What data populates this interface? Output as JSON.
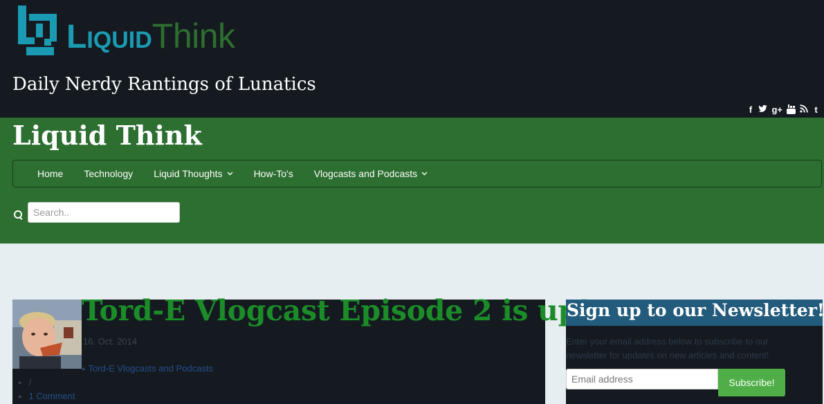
{
  "header": {
    "logo_text_liquid": "Liquid",
    "logo_text_think": "Think",
    "tagline": "Daily Nerdy Rantings of Lunatics",
    "social": [
      {
        "icon": "facebook-icon",
        "glyph": "f"
      },
      {
        "icon": "twitter-icon",
        "glyph": "t"
      },
      {
        "icon": "googleplus-icon",
        "glyph": "g+"
      },
      {
        "icon": "youtube-icon",
        "glyph": "▶"
      },
      {
        "icon": "rss-icon",
        "glyph": "≈"
      },
      {
        "icon": "tumblr-icon",
        "glyph": "t"
      }
    ]
  },
  "site": {
    "title": "Liquid Think"
  },
  "nav": {
    "items": [
      {
        "label": "Home",
        "dropdown": false
      },
      {
        "label": "Technology",
        "dropdown": false
      },
      {
        "label": "Liquid Thoughts",
        "dropdown": true
      },
      {
        "label": "How-To's",
        "dropdown": false
      },
      {
        "label": "Vlogcasts and Podcasts",
        "dropdown": true
      }
    ]
  },
  "search": {
    "placeholder": "Search.."
  },
  "post": {
    "title": "Tord-E Vlogcast Episode 2 is up!",
    "date": "16. Oct. 2014",
    "category": "Tord-E Vlogcasts and Podcasts",
    "separator": "/",
    "comments": "1 Comment"
  },
  "newsletter": {
    "title": "Sign up to our Newsletter!",
    "description": "Enter your email address below to subscribe to our newsletter for updates on new articles and content!",
    "email_placeholder": "Email address",
    "subscribe_label": "Subscribe!"
  },
  "colors": {
    "header_bg": "#141a20",
    "green_band": "#2d6e31",
    "post_title": "#1c8c28",
    "newsletter_head": "#235b7c",
    "subscribe_button": "#4fae47"
  }
}
